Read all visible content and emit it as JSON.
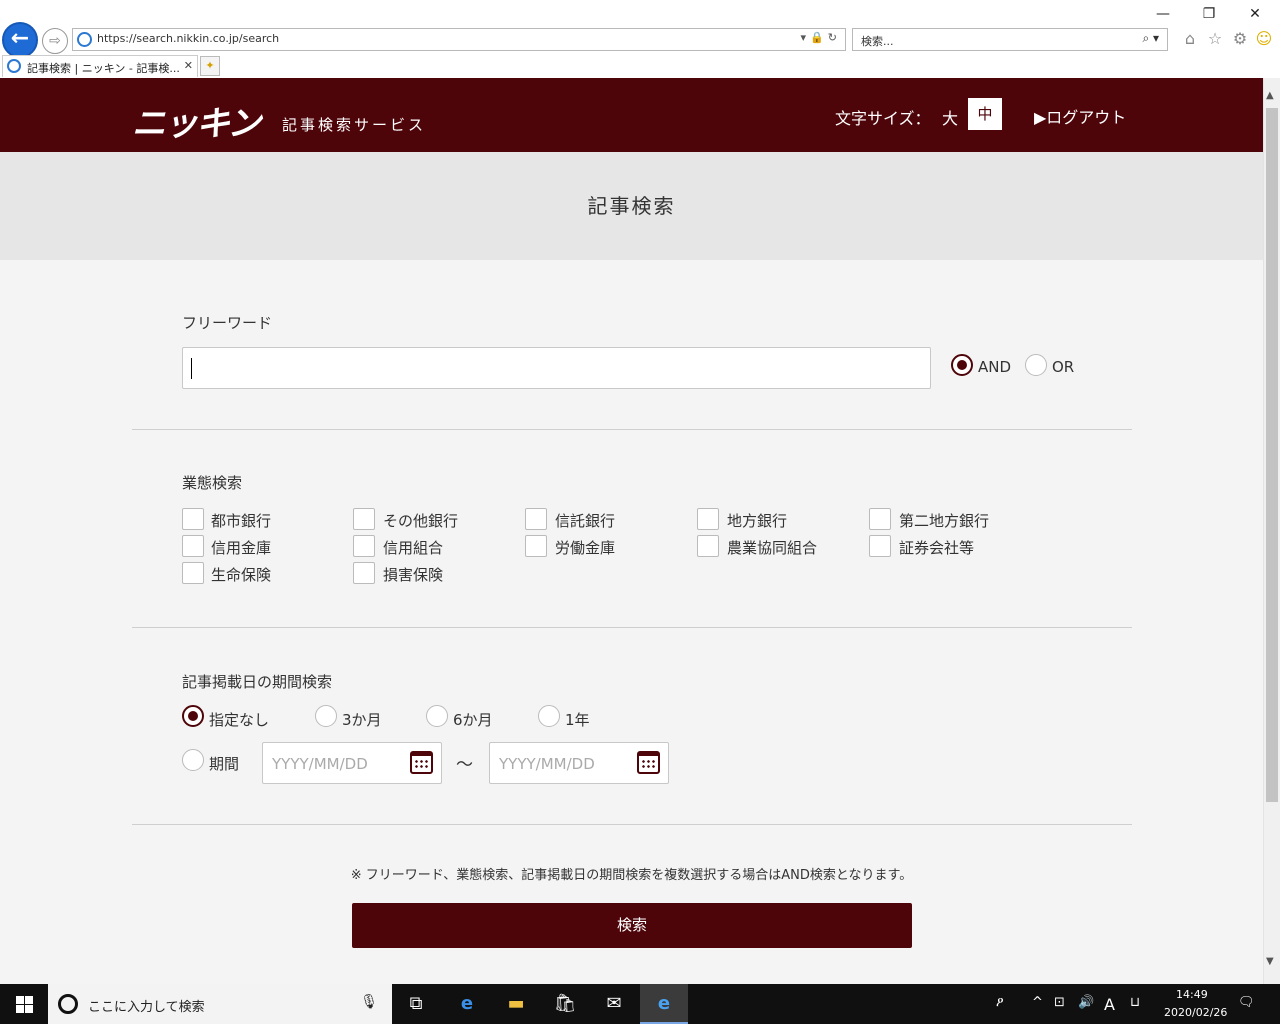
{
  "browser": {
    "url": "https://search.nikkin.co.jp/search",
    "search_placeholder": "検索...",
    "tab_title": "記事検索 | ニッキン - 記事検...",
    "tab_close": "✕"
  },
  "header": {
    "logo": "ニッキン",
    "logo_sub": "記事検索サービス",
    "font_size_label": "文字サイズ：",
    "font_size_large": "大",
    "font_size_medium": "中",
    "logout": "▶ログアウト"
  },
  "page_title": "記事検索",
  "freeword": {
    "label": "フリーワード",
    "value": "",
    "and_label": "AND",
    "or_label": "OR",
    "selected": "AND"
  },
  "business": {
    "label": "業態検索",
    "items": [
      "都市銀行",
      "その他銀行",
      "信託銀行",
      "地方銀行",
      "第二地方銀行",
      "信用金庫",
      "信用組合",
      "労働金庫",
      "農業協同組合",
      "証券会社等",
      "生命保険",
      "損害保険"
    ]
  },
  "period": {
    "label": "記事掲載日の期間検索",
    "options": [
      "指定なし",
      "3か月",
      "6か月",
      "1年"
    ],
    "selected": "指定なし",
    "range_label": "期間",
    "from_placeholder": "YYYY/MM/DD",
    "to_placeholder": "YYYY/MM/DD",
    "tilde": "〜"
  },
  "note": "※ フリーワード、業態検索、記事掲載日の期間検索を複数選択する場合はAND検索となります。",
  "search_button": "検索",
  "taskbar": {
    "search_placeholder": "ここに入力して検索",
    "time": "14:49",
    "date": "2020/02/26",
    "ime": "A"
  }
}
